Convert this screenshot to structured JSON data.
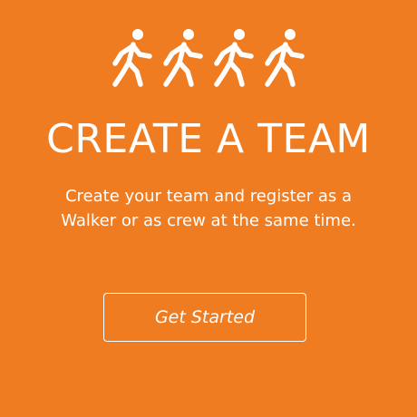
{
  "colors": {
    "background": "#f07c22",
    "foreground": "#ffffff"
  },
  "icons": [
    "walking-person-icon",
    "walking-person-icon",
    "walking-person-icon",
    "walking-person-icon"
  ],
  "hero": {
    "title": "CREATE A TEAM",
    "description": "Create your team and register as a Walker or as crew at the same time."
  },
  "cta": {
    "label": "Get Started"
  }
}
